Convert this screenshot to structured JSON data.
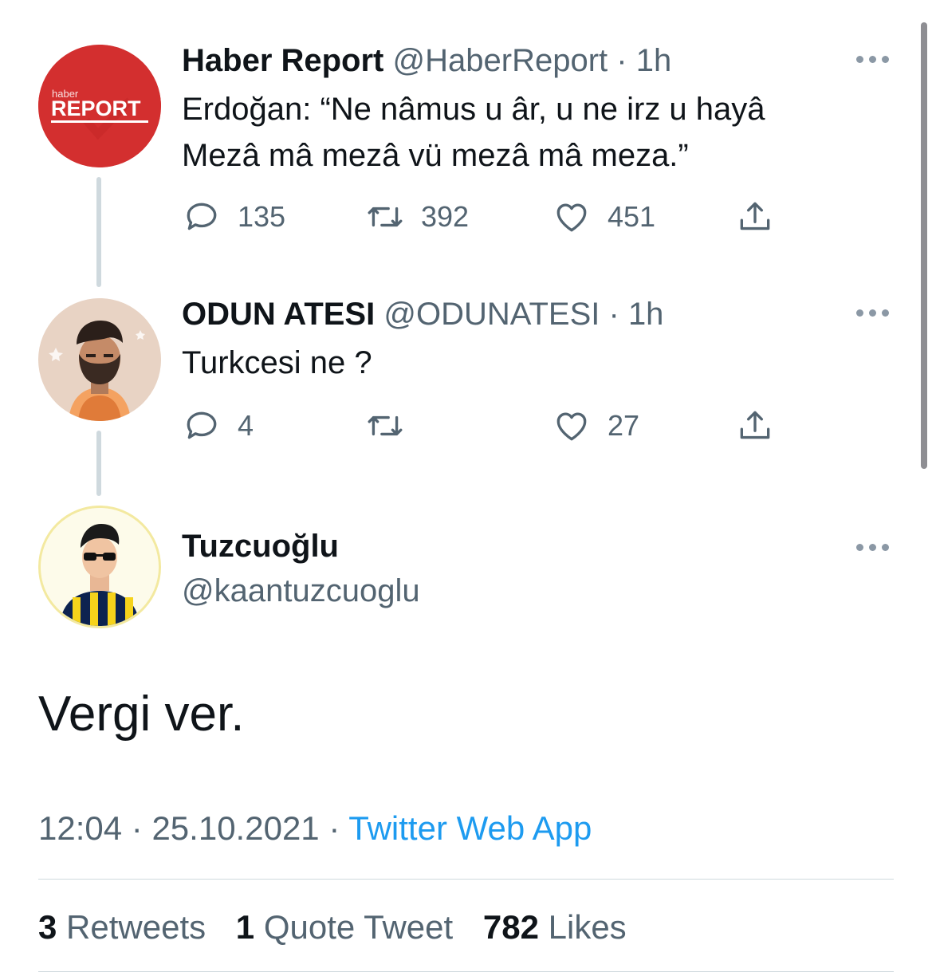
{
  "colors": {
    "accent": "#1d9bf0",
    "secondary_text": "#536471",
    "thread_line": "#cfd9de",
    "report_red": "#d32f2f"
  },
  "tweets": [
    {
      "name": "Haber Report",
      "handle": "@HaberReport",
      "separator": "·",
      "time": "1h",
      "text_lines": [
        "Erdoğan: “Ne nâmus u âr, u ne irz u hayâ",
        "Mezâ mâ mezâ vü mezâ mâ meza.”"
      ],
      "avatar": {
        "logo_small": "haber",
        "logo_big": "REPORT"
      },
      "replies": "135",
      "retweets": "392",
      "likes": "451"
    },
    {
      "name": "ODUN ATESI",
      "handle": "@ODUNATESI",
      "separator": "·",
      "time": "1h",
      "text_lines": [
        "Turkcesi ne ?"
      ],
      "replies": "4",
      "retweets": "",
      "likes": "27"
    }
  ],
  "main": {
    "name": "Tuzcuoğlu",
    "handle": "@kaantuzcuoglu",
    "text": "Vergi ver.",
    "time": "12:04",
    "date": "25.10.2021",
    "separator": "·",
    "app": "Twitter Web App",
    "retweet_count": "3",
    "retweet_label": "Retweets",
    "quote_count": "1",
    "quote_label": "Quote Tweet",
    "like_count": "782",
    "like_label": "Likes"
  },
  "icons": [
    "reply-icon",
    "retweet-icon",
    "like-icon",
    "share-icon",
    "more-icon"
  ]
}
